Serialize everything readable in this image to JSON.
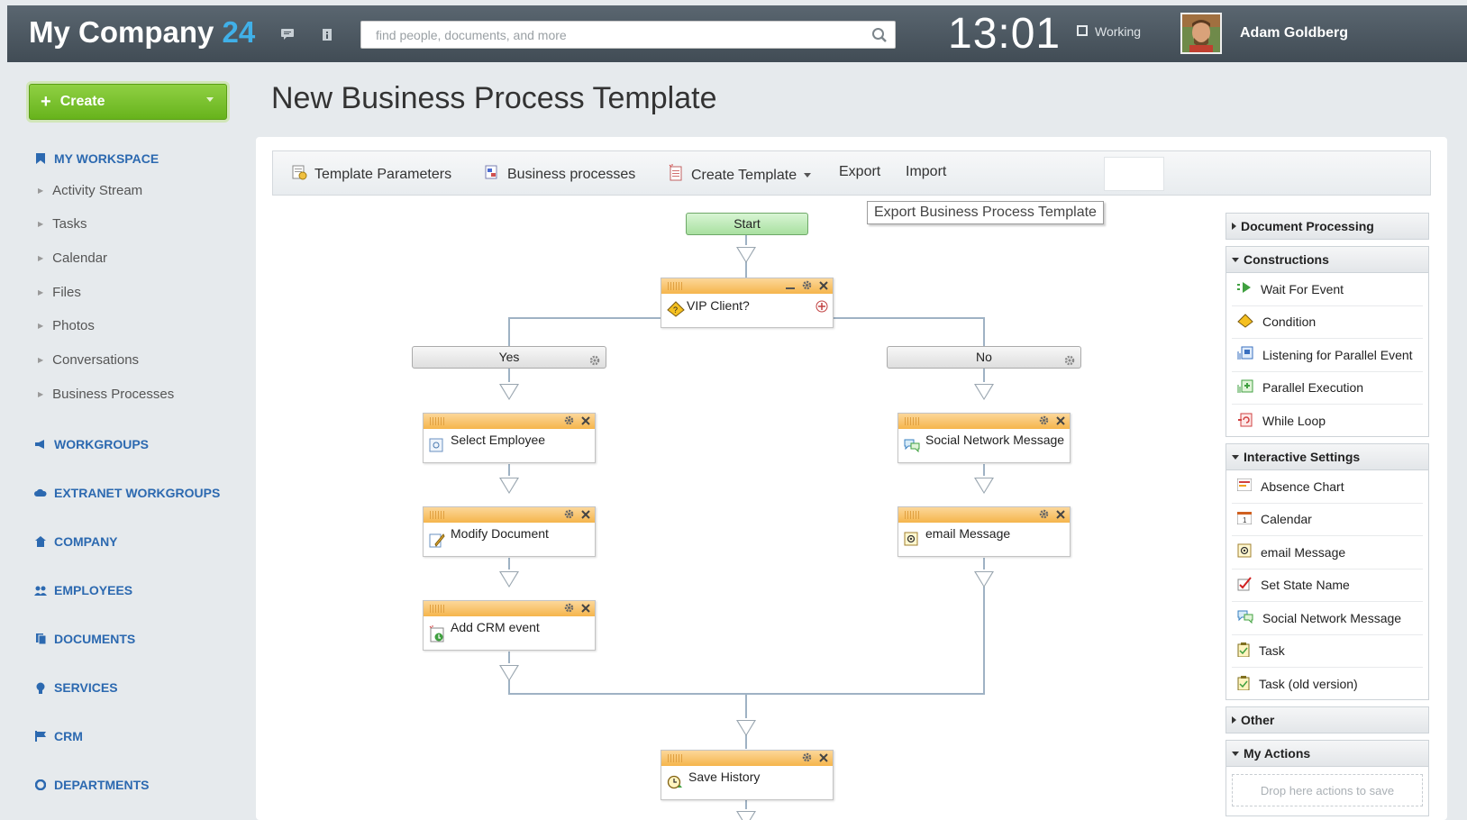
{
  "header": {
    "logo_main": "My Company",
    "logo_num": "24",
    "search_placeholder": "find people, documents, and more",
    "clock": "13:01",
    "status": "Working",
    "user_name": "Adam Goldberg"
  },
  "sidebar": {
    "create_label": "Create",
    "workspace_label": "MY WORKSPACE",
    "items": [
      {
        "label": "Activity Stream"
      },
      {
        "label": "Tasks"
      },
      {
        "label": "Calendar"
      },
      {
        "label": "Files"
      },
      {
        "label": "Photos"
      },
      {
        "label": "Conversations"
      },
      {
        "label": "Business Processes"
      }
    ],
    "sections": [
      {
        "label": "WORKGROUPS"
      },
      {
        "label": "EXTRANET WORKGROUPS"
      },
      {
        "label": "COMPANY"
      },
      {
        "label": "EMPLOYEES"
      },
      {
        "label": "DOCUMENTS"
      },
      {
        "label": "SERVICES"
      },
      {
        "label": "CRM"
      },
      {
        "label": "DEPARTMENTS"
      }
    ]
  },
  "main": {
    "title": "New Business Process Template",
    "toolbar": {
      "template_parameters": "Template Parameters",
      "business_processes": "Business processes",
      "create_template": "Create Template",
      "export": "Export",
      "import": "Import"
    },
    "tooltip": "Export Business Process Template"
  },
  "flow": {
    "start": "Start",
    "condition": "VIP Client?",
    "branch_yes": "Yes",
    "branch_no": "No",
    "left_actions": [
      "Select Employee",
      "Modify Document",
      "Add CRM event"
    ],
    "right_actions": [
      "Social Network Message",
      "email Message"
    ],
    "final_action": "Save History"
  },
  "palette": {
    "document_processing": "Document Processing",
    "constructions": {
      "title": "Constructions",
      "items": [
        "Wait For Event",
        "Condition",
        "Listening for Parallel Event",
        "Parallel Execution",
        "While Loop"
      ]
    },
    "interactive": {
      "title": "Interactive Settings",
      "items": [
        "Absence Chart",
        "Calendar",
        "email Message",
        "Set State Name",
        "Social Network Message",
        "Task",
        "Task (old version)"
      ]
    },
    "other": "Other",
    "my_actions": {
      "title": "My Actions",
      "drop_hint": "Drop here actions to save"
    }
  },
  "colors": {
    "header_bg": "#4a555e",
    "accent_blue": "#2c69b0",
    "create_green": "#7cc232",
    "action_bar_orange": "#f7c06a",
    "start_green": "#bfeab7"
  }
}
